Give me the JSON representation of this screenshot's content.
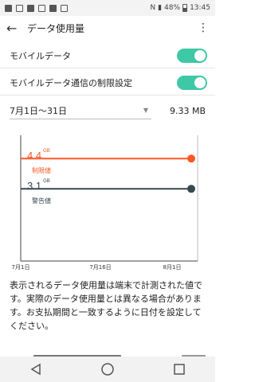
{
  "status_bar": {
    "battery": "48%",
    "time": "13:45"
  },
  "app_bar": {
    "title": "データ使用量",
    "back_icon": "arrow-left-icon",
    "more_icon": "more-vert-icon"
  },
  "settings": [
    {
      "label": "モバイルデータ",
      "enabled": true
    },
    {
      "label": "モバイルデータ通信の制限設定",
      "enabled": true
    }
  ],
  "period": {
    "range": "7月1日～31日",
    "total": "9.33 MB"
  },
  "chart_data": {
    "type": "line",
    "x_ticks": [
      "7月1日",
      "7月16日",
      "8月1日"
    ],
    "series": [
      {
        "name": "制限値",
        "value": 4.4,
        "unit": "GB",
        "color": "#ff5722"
      },
      {
        "name": "警告値",
        "value": 3.1,
        "unit": "GB",
        "color": "#37474f"
      }
    ]
  },
  "description": "表示されるデータ使用量は端末で計測された値です。実際のデータ使用量とは異なる場合があります。お支払期間と一致するように日付を設定してください。",
  "colors": {
    "accent": "#3fc8a6",
    "limit": "#ff5722",
    "warning": "#37474f"
  }
}
